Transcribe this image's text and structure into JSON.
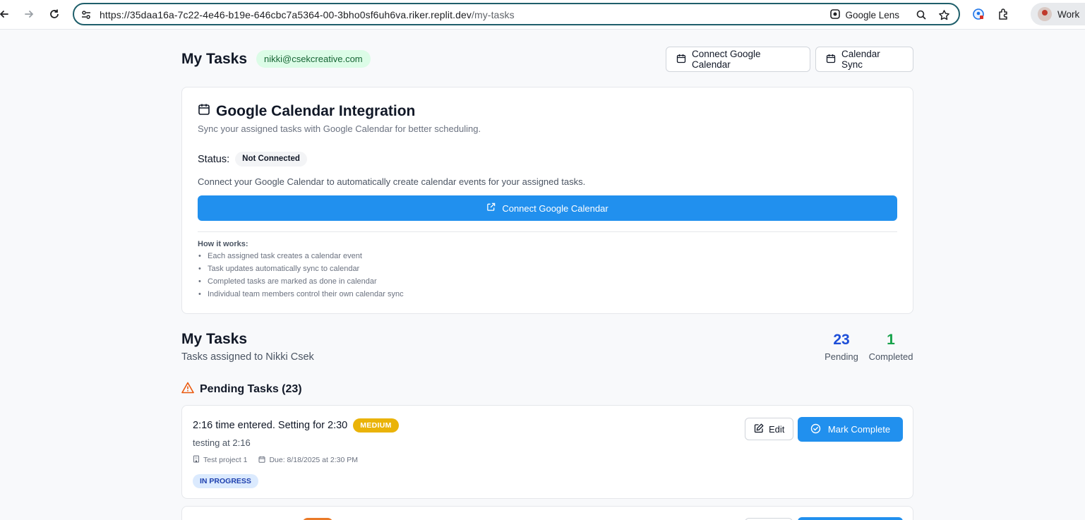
{
  "browser": {
    "url_host": "https://35daa16a-7c22-4e46-b19e-646cbc7a5364-00-3bho0sf6uh6va.riker.replit.dev",
    "url_path": "/my-tasks",
    "lens_label": "Google Lens",
    "profile_label": "Work"
  },
  "header": {
    "title": "My Tasks",
    "email": "nikki@csekcreative.com",
    "connect_button": "Connect Google Calendar",
    "sync_button": "Calendar Sync"
  },
  "integration": {
    "title": "Google Calendar Integration",
    "subtitle": "Sync your assigned tasks with Google Calendar for better scheduling.",
    "status_label": "Status:",
    "status_value": "Not Connected",
    "description": "Connect your Google Calendar to automatically create calendar events for your assigned tasks.",
    "connect_button": "Connect Google Calendar",
    "how_title": "How it works:",
    "how_items": [
      "Each assigned task creates a calendar event",
      "Task updates automatically sync to calendar",
      "Completed tasks are marked as done in calendar",
      "Individual team members control their own calendar sync"
    ]
  },
  "tasks_section": {
    "title": "My Tasks",
    "subtitle": "Tasks assigned to Nikki Csek",
    "pending_count": "23",
    "pending_label": "Pending",
    "completed_count": "1",
    "completed_label": "Completed",
    "pending_heading": "Pending Tasks (23)"
  },
  "tasks": [
    {
      "title": "2:16 time entered. Setting for 2:30",
      "priority": "MEDIUM",
      "description": "testing at 2:16",
      "project": "Test project 1",
      "due": "Due: 8/18/2025 at 2:30 PM",
      "status": "IN PROGRESS",
      "edit_label": "Edit",
      "complete_label": "Mark Complete"
    }
  ],
  "colors": {
    "accent": "#2190ee",
    "priority_medium": "#eab308",
    "pending_number": "#1d4ed8",
    "completed_number": "#16a34a",
    "warning": "#ea580c"
  }
}
